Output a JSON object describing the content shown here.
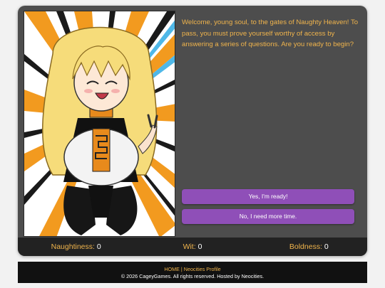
{
  "dialogue": {
    "message": "Welcome, young soul, to the gates of Naughty Heaven! To pass, you must prove yourself worthy of access by answering a series of questions. Are you ready to begin?"
  },
  "choices": [
    {
      "label": "Yes, I'm ready!"
    },
    {
      "label": "No, I need more time."
    }
  ],
  "stats": {
    "naughtiness": {
      "label": "Naughtiness:",
      "value": "0"
    },
    "wit": {
      "label": "Wit:",
      "value": "0"
    },
    "boldness": {
      "label": "Boldness:",
      "value": "0"
    }
  },
  "footer": {
    "home_link": "HOME",
    "separator": "|",
    "profile_link": "Neocities Profile",
    "copyright": "© 2026 CageyGames. All rights reserved. Hosted by Neocities."
  },
  "colors": {
    "accent": "#f0b44c",
    "button": "#8f4fb8",
    "panel": "#4d4d4d",
    "stats_bar": "#222222",
    "footer": "#111111"
  }
}
